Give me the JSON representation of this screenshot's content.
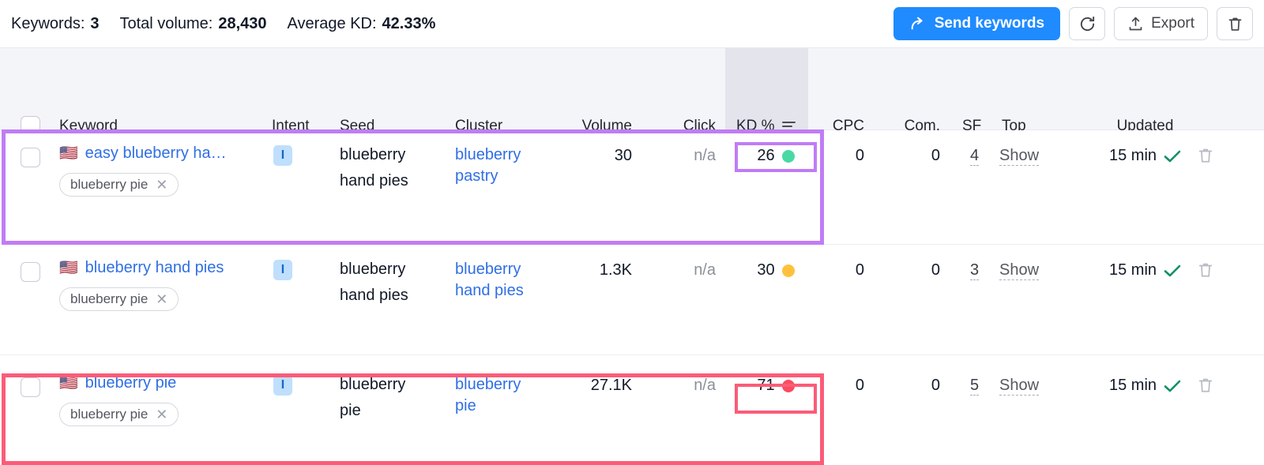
{
  "toolbar": {
    "summary": [
      {
        "label": "Keywords:",
        "value": "3"
      },
      {
        "label": "Total volume:",
        "value": "28,430"
      },
      {
        "label": "Average KD:",
        "value": "42.33%"
      }
    ],
    "send_keywords_label": "Send keywords",
    "send_keywords_icon": "share-arrow-icon",
    "refresh_icon": "refresh-icon",
    "export_label": "Export",
    "export_icon": "upload-icon",
    "delete_icon": "trash-icon",
    "accent_blue": "#1f8bff"
  },
  "table": {
    "headers": {
      "select_all": "select-all-checkbox",
      "keyword": "Keyword",
      "intent": "Intent",
      "seed_keyword": "Seed keyword",
      "cluster": "Cluster",
      "volume": "Volume",
      "click_potential": "Click potential",
      "kd": "KD %",
      "kd_sort_icon": "sort-descending-icon",
      "cpc": "CPC (USD)",
      "com_density": "Com. Density",
      "sf": "SF",
      "top_comp": "Top Comp.",
      "updated": "Updated"
    },
    "rows": [
      {
        "flag": "🇺🇸",
        "keyword": "easy blueberry ha…",
        "tag": "blueberry pie",
        "tag_remove_icon": "close-icon",
        "intent": "I",
        "seed_keyword": "blueberry hand pies",
        "cluster": "blueberry pastry",
        "volume": "30",
        "click_potential": "n/a",
        "kd": "26",
        "kd_color": "#4ad9a4",
        "cpc": "0",
        "com_density": "0",
        "sf": "4",
        "top_comp": "Show",
        "updated": "15 min",
        "updated_icon": "check-icon",
        "delete_icon": "trash-icon",
        "highlight": "purple"
      },
      {
        "flag": "🇺🇸",
        "keyword": "blueberry hand pies",
        "tag": "blueberry pie",
        "tag_remove_icon": "close-icon",
        "intent": "I",
        "seed_keyword": "blueberry hand pies",
        "cluster": "blueberry hand pies",
        "volume": "1.3K",
        "click_potential": "n/a",
        "kd": "30",
        "kd_color": "#ffc13c",
        "cpc": "0",
        "com_density": "0",
        "sf": "3",
        "top_comp": "Show",
        "updated": "15 min",
        "updated_icon": "check-icon",
        "delete_icon": "trash-icon",
        "highlight": "none"
      },
      {
        "flag": "🇺🇸",
        "keyword": "blueberry pie",
        "tag": "blueberry pie",
        "tag_remove_icon": "close-icon",
        "intent": "I",
        "seed_keyword": "blueberry pie",
        "cluster": "blueberry pie",
        "volume": "27.1K",
        "click_potential": "n/a",
        "kd": "71",
        "kd_color": "#fb4b5e",
        "cpc": "0",
        "com_density": "0",
        "sf": "5",
        "top_comp": "Show",
        "updated": "15 min",
        "updated_icon": "check-icon",
        "delete_icon": "trash-icon",
        "highlight": "pink"
      }
    ]
  },
  "annotations": {
    "purple": "#c07cf5",
    "pink": "#fb5c78"
  }
}
